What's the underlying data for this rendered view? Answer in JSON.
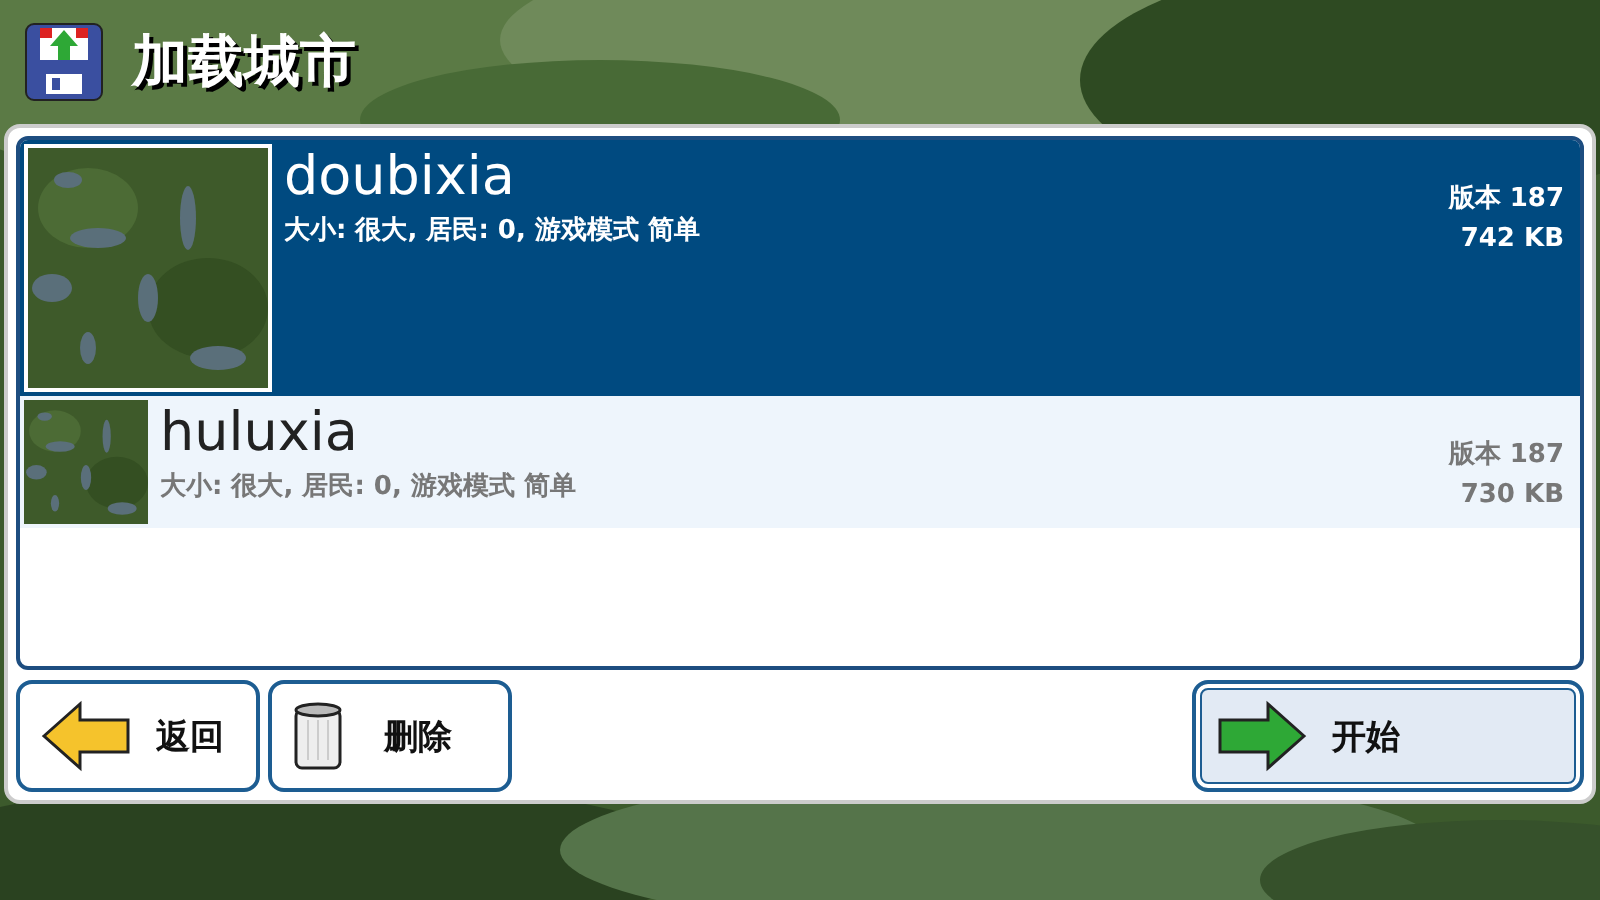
{
  "title": "加载城市",
  "cities": [
    {
      "name": "doubixia",
      "details": "大小: 很大, 居民: 0, 游戏模式 简单",
      "version": "版本 187",
      "size": "742 KB",
      "selected": true
    },
    {
      "name": "huluxia",
      "details": "大小: 很大, 居民: 0, 游戏模式 简单",
      "version": "版本 187",
      "size": "730 KB",
      "selected": false
    }
  ],
  "buttons": [
    {
      "kind": "back",
      "label": "返回",
      "selected": false
    },
    {
      "kind": "delete",
      "label": "删除",
      "selected": false
    },
    {
      "kind": "start",
      "label": "开始",
      "selected": true
    }
  ]
}
